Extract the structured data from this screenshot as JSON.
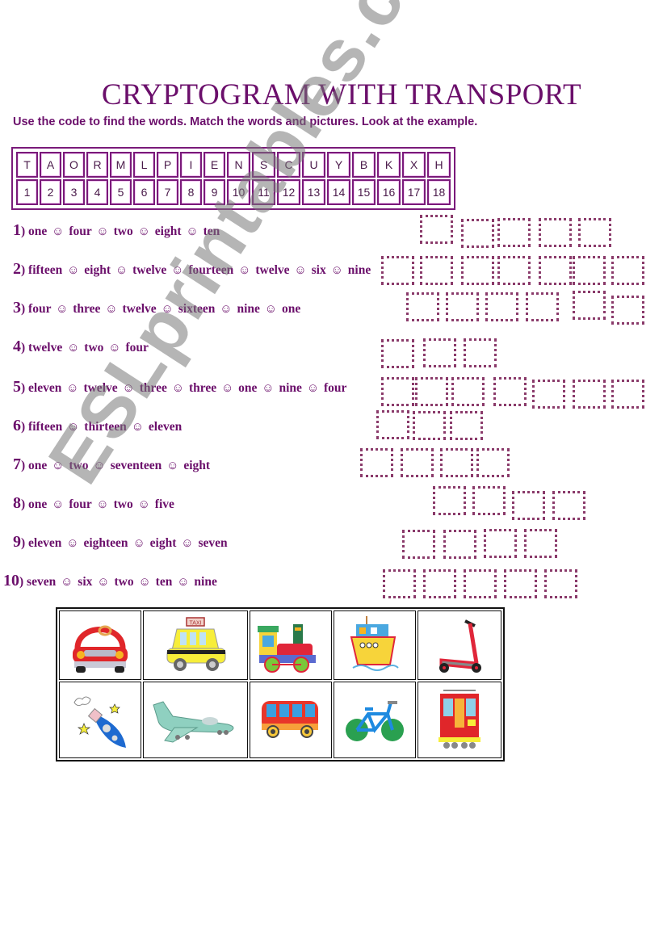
{
  "title": "CRYPTOGRAM WITH TRANSPORT",
  "instructions": "Use the code to find the words. Match the words and pictures. Look at the example.",
  "code": {
    "letters": [
      "T",
      "A",
      "O",
      "R",
      "M",
      "L",
      "P",
      "I",
      "E",
      "N",
      "S",
      "C",
      "U",
      "Y",
      "B",
      "K",
      "X",
      "H"
    ],
    "numbers": [
      "1",
      "2",
      "3",
      "4",
      "5",
      "6",
      "7",
      "8",
      "9",
      "10",
      "11",
      "12",
      "13",
      "14",
      "15",
      "16",
      "17",
      "18"
    ]
  },
  "separator": "☺",
  "clues": [
    {
      "num": "1",
      "words": [
        "one",
        "four",
        "two",
        "eight",
        "ten"
      ]
    },
    {
      "num": "2",
      "words": [
        "fifteen",
        "eight",
        "twelve",
        "fourteen",
        "twelve",
        "six",
        "nine"
      ]
    },
    {
      "num": "3",
      "words": [
        "four",
        "three",
        "twelve",
        "sixteen",
        "nine",
        "one"
      ]
    },
    {
      "num": "4",
      "words": [
        "twelve",
        "two",
        "four"
      ]
    },
    {
      "num": "5",
      "words": [
        "eleven",
        "twelve",
        "three",
        "three",
        "one",
        "nine",
        "four"
      ]
    },
    {
      "num": "6",
      "words": [
        "fifteen",
        "thirteen",
        "eleven"
      ]
    },
    {
      "num": "7",
      "words": [
        "one",
        "two",
        "seventeen",
        "eight"
      ]
    },
    {
      "num": "8",
      "words": [
        "one",
        "four",
        "two",
        "five"
      ]
    },
    {
      "num": "9",
      "words": [
        "eleven",
        "eighteen",
        "eight",
        "seven"
      ]
    },
    {
      "num": "10",
      "words": [
        "seven",
        "six",
        "two",
        "ten",
        "nine"
      ]
    }
  ],
  "pictures": [
    [
      "car-picture",
      "taxi-picture",
      "train-picture",
      "ship-picture",
      "scooter-picture"
    ],
    [
      "rocket-picture",
      "plane-picture",
      "bus-picture",
      "bicycle-picture",
      "tram-picture"
    ]
  ],
  "watermark": "ESLprintables.com"
}
